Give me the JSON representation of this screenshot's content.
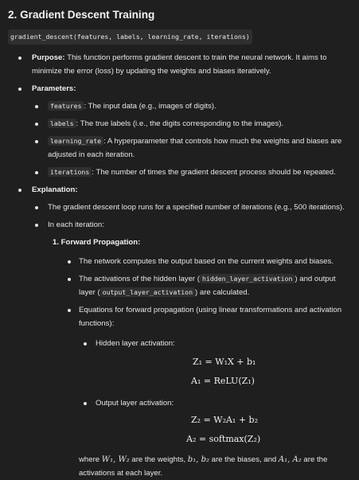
{
  "heading": "2. Gradient Descent Training",
  "signature": "gradient_descent(features, labels, learning_rate, iterations)",
  "purpose": {
    "label": "Purpose:",
    "text": " This function performs gradient descent to train the neural network. It aims to minimize the error (loss) by updating the weights and biases iteratively."
  },
  "parameters": {
    "label": "Parameters:",
    "items": [
      {
        "code": "features",
        "text": ": The input data (e.g., images of digits)."
      },
      {
        "code": "labels",
        "text": ": The true labels (i.e., the digits corresponding to the images)."
      },
      {
        "code": "learning_rate",
        "text": ": A hyperparameter that controls how much the weights and biases are adjusted in each iteration."
      },
      {
        "code": "iterations",
        "text": ": The number of times the gradient descent process should be repeated."
      }
    ]
  },
  "explanation": {
    "label": "Explanation:",
    "loop_text": "The gradient descent loop runs for a specified number of iterations (e.g., 500 iterations).",
    "each_iter": "In each iteration:",
    "forward": {
      "label": "1. Forward Propagation:",
      "b1": "The network computes the output based on the current weights and biases.",
      "b2_pre": "The activations of the hidden layer (",
      "b2_code1": "hidden_layer_activation",
      "b2_mid": ") and output layer (",
      "b2_code2": "output_layer_activation",
      "b2_post": ") are calculated.",
      "b3": "Equations for forward propagation (using linear transformations and activation functions):",
      "hidden_label": "Hidden layer activation:",
      "eq1": "Z₁ = W₁X + b₁",
      "eq2": "A₁ = ReLU(Z₁)",
      "output_label": "Output layer activation:",
      "eq3": "Z₂ = W₂A₁ + b₂",
      "eq4": "A₂ = softmax(Z₂)",
      "where_pre": "where ",
      "where_w": "W₁, W₂",
      "where_mid1": " are the weights, ",
      "where_b": "b₁, b₂",
      "where_mid2": " are the biases, and ",
      "where_a": "A₁, A₂",
      "where_post": " are the activations at each layer."
    }
  }
}
